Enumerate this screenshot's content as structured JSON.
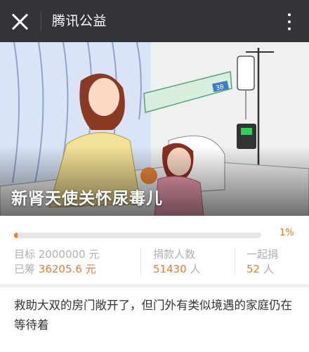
{
  "header": {
    "title": "腾讯公益"
  },
  "hero": {
    "title": "新肾天使关怀尿毒儿",
    "wall_sign": "38"
  },
  "progress": {
    "percent": 1,
    "percent_label": "1%"
  },
  "stats": {
    "target_label": "目标",
    "target_value": "2000000 元",
    "raised_label": "已筹",
    "raised_value": "36205.6",
    "raised_unit": "元",
    "donors_label": "捐款人数",
    "donors_value": "51430",
    "donors_unit": "人",
    "together_label": "一起捐",
    "together_value": "52",
    "together_unit": "人"
  },
  "description": {
    "text": "救助大双的房门敞开了，但门外有类似境遇的家庭仍在等待着"
  },
  "colors": {
    "accent": "#f47b2a",
    "topbar": "#333438"
  }
}
